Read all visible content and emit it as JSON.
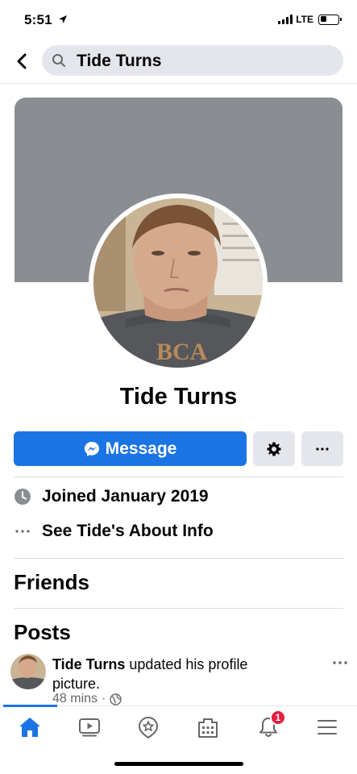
{
  "status_bar": {
    "time": "5:51",
    "network": "LTE",
    "battery_level": 0.35,
    "signal_bars": 4
  },
  "header": {
    "search_query": "Tide Turns",
    "back_icon": "chevron-left-icon",
    "search_icon": "search-icon"
  },
  "profile": {
    "name": "Tide Turns",
    "cover_color": "#8a8d91",
    "avatar_icon": "profile-photo"
  },
  "actions": {
    "message_label": "Message",
    "message_icon": "messenger-icon",
    "settings_icon": "gear-icon",
    "more_icon": "more-icon",
    "accent_color": "#1b74e4"
  },
  "intro": {
    "items": [
      {
        "icon": "clock-icon",
        "text": "Joined January 2019"
      },
      {
        "icon": "more-horizontal-icon",
        "text": "See Tide's About Info"
      }
    ]
  },
  "sections": {
    "friends_title": "Friends",
    "posts_title": "Posts"
  },
  "post": {
    "author": "Tide Turns",
    "action": " updated his profile picture.",
    "time": "48 mins",
    "separator": "·",
    "privacy_icon": "globe-icon"
  },
  "tab_bar": {
    "tabs": [
      {
        "name": "home",
        "icon": "home-icon",
        "active": true
      },
      {
        "name": "watch",
        "icon": "video-icon",
        "active": false
      },
      {
        "name": "dating",
        "icon": "star-badge-icon",
        "active": false
      },
      {
        "name": "marketplace",
        "icon": "shop-icon",
        "active": false
      },
      {
        "name": "notifications",
        "icon": "bell-icon",
        "active": false
      },
      {
        "name": "menu",
        "icon": "menu-icon",
        "active": false
      }
    ],
    "notification_count": "1",
    "badge_color": "#e41e3f"
  }
}
